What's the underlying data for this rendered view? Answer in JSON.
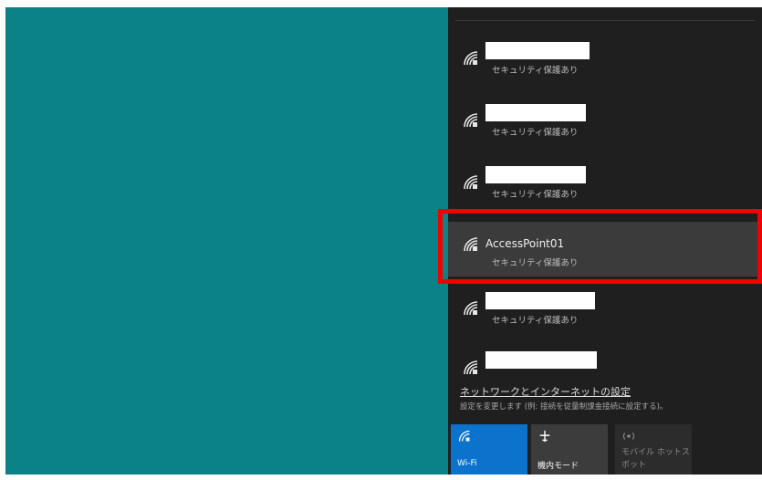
{
  "networks": [
    {
      "ssid": "",
      "security": "セキュリティ保護あり",
      "selected": false
    },
    {
      "ssid": "",
      "security": "セキュリティ保護あり",
      "selected": false
    },
    {
      "ssid": "",
      "security": "セキュリティ保護あり",
      "selected": false
    },
    {
      "ssid": "AccessPoint01",
      "security": "セキュリティ保護あり",
      "selected": true
    },
    {
      "ssid": "",
      "security": "セキュリティ保護あり",
      "selected": false
    },
    {
      "ssid": "",
      "security": "",
      "selected": false
    }
  ],
  "settings": {
    "link_text": "ネットワークとインターネットの設定",
    "description": "設定を変更します (例: 接続を従量制課金接続に設定する)。"
  },
  "quick_actions": {
    "wifi_label": "Wi-Fi",
    "airplane_label": "機内モード",
    "hotspot_label": "モバイル ホットスポット"
  },
  "icons": {
    "wifi": "wifi-icon",
    "airplane": "airplane-icon",
    "hotspot": "hotspot-icon"
  },
  "colors": {
    "desktop_bg": "#0b8386",
    "panel_bg": "#1f1f1f",
    "selected_bg": "#3b3b3b",
    "highlight": "#f20000",
    "wifi_tile": "#0b73cc"
  }
}
